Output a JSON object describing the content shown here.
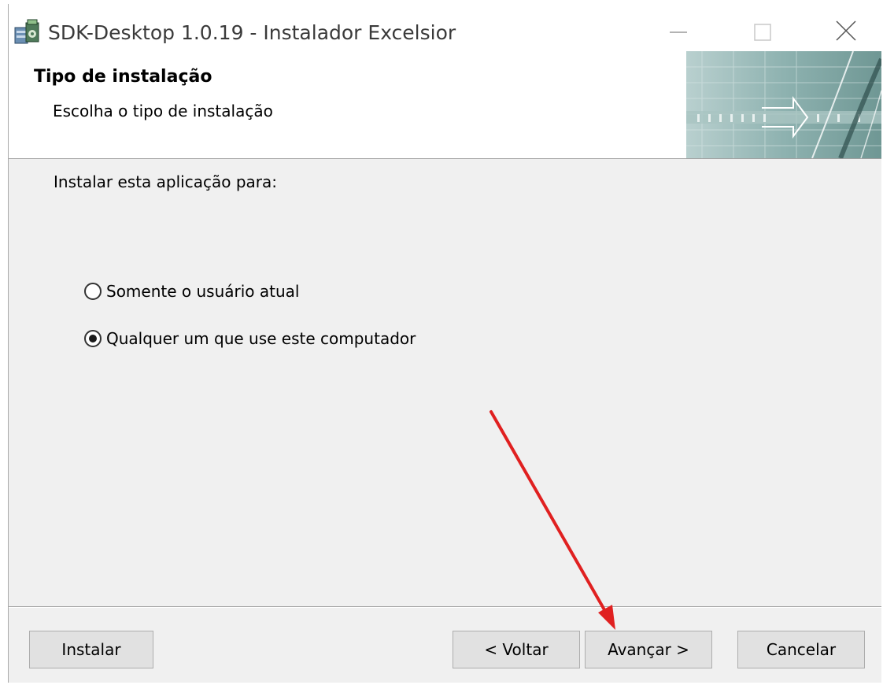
{
  "window": {
    "title": "SDK-Desktop 1.0.19 - Instalador Excelsior",
    "icon": "installer-app-icon"
  },
  "header": {
    "title": "Tipo de instalação",
    "subtitle": "Escolha o tipo de instalação"
  },
  "content": {
    "prompt": "Instalar esta aplicação para:",
    "options": [
      {
        "label": "Somente o usuário atual",
        "selected": false
      },
      {
        "label": "Qualquer um que use este computador",
        "selected": true
      }
    ]
  },
  "buttons": {
    "install": "Instalar",
    "back": "< Voltar",
    "next": "Avançar >",
    "cancel": "Cancelar"
  },
  "colors": {
    "annotation_arrow": "#e02020",
    "dialog_background": "#f0f0f0",
    "button_face": "#e1e1e1",
    "banner_teal": "#7fa8a6"
  }
}
